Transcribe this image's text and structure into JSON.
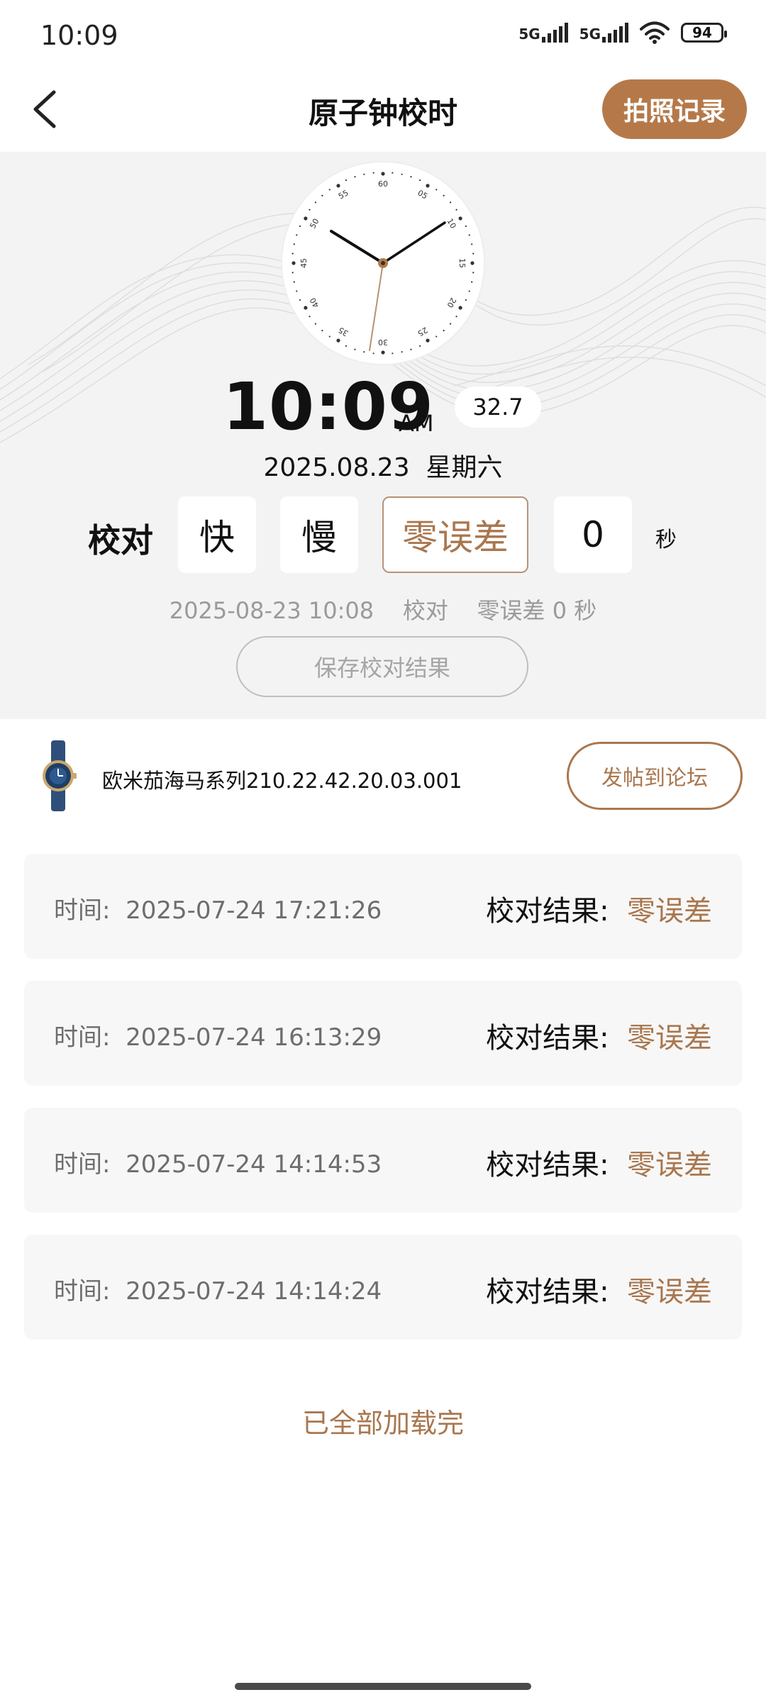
{
  "status_bar": {
    "time": "10:09",
    "network_1": "5G",
    "network_2": "5G",
    "battery": "94"
  },
  "header": {
    "title": "原子钟校时",
    "photo_record_label": "拍照记录"
  },
  "clock": {
    "time": "10:09",
    "ampm": "AM",
    "seconds": "32.7",
    "date": "2025.08.23",
    "weekday": "星期六",
    "dial_numbers": [
      "60",
      "05",
      "10",
      "15",
      "20",
      "25",
      "30",
      "35",
      "40",
      "45",
      "50",
      "55"
    ]
  },
  "calibration": {
    "label": "校对",
    "fast_label": "快",
    "slow_label": "慢",
    "zero_label": "零误差",
    "seconds_value": "0",
    "unit": "秒",
    "selected": "零误差"
  },
  "last_record": {
    "datetime": "2025-08-23 10:08",
    "action": "校对",
    "result": "零误差 0 秒"
  },
  "save_button_label": "保存校对结果",
  "watch": {
    "name": "欧米茄海马系列210.22.42.20.03.001",
    "post_button_label": "发帖到论坛"
  },
  "records": [
    {
      "time_label": "时间:",
      "time_value": "2025-07-24 17:21:26",
      "result_label": "校对结果:",
      "result_value": "零误差"
    },
    {
      "time_label": "时间:",
      "time_value": "2025-07-24 16:13:29",
      "result_label": "校对结果:",
      "result_value": "零误差"
    },
    {
      "time_label": "时间:",
      "time_value": "2025-07-24 14:14:53",
      "result_label": "校对结果:",
      "result_value": "零误差"
    },
    {
      "time_label": "时间:",
      "time_value": "2025-07-24 14:14:24",
      "result_label": "校对结果:",
      "result_value": "零误差"
    }
  ],
  "load_complete": "已全部加载完",
  "colors": {
    "accent": "#b57949",
    "accent_text": "#a9774f",
    "hero_bg": "#f3f3f3",
    "record_bg": "#f7f7f7"
  },
  "icons": {
    "back": "chevron-left-icon",
    "wifi": "wifi-icon",
    "signal": "signal-icon",
    "battery": "battery-icon"
  }
}
